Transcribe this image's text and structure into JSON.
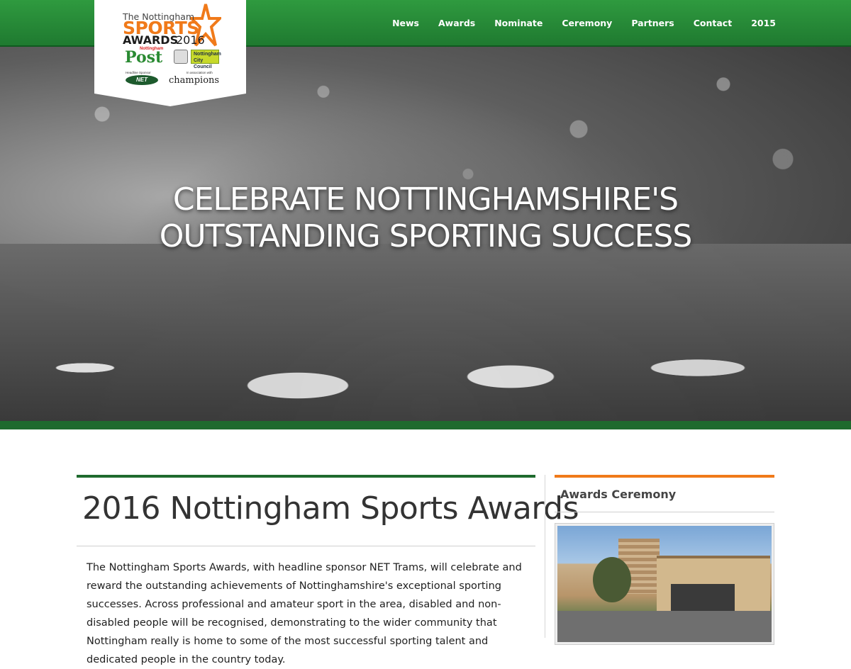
{
  "logo": {
    "line1": "The Nottingham",
    "sports": "SPORTS",
    "awards": "AWARDS",
    "year": "2016",
    "post_top": "Nottingham",
    "post": "Post",
    "council": "Nottingham City Council",
    "net_label": "Headline Sponsor",
    "net": "NET",
    "champions_label": "In association with",
    "champions": "champions"
  },
  "nav": {
    "items": [
      "News",
      "Awards",
      "Nominate",
      "Ceremony",
      "Partners",
      "Contact",
      "2015"
    ]
  },
  "hero": {
    "heading_line1": "CELEBRATE NOTTINGHAMSHIRE'S",
    "heading_line2": "OUTSTANDING SPORTING SUCCESS"
  },
  "main": {
    "title": "2016 Nottingham Sports Awards",
    "body": "The Nottingham Sports Awards, with headline sponsor NET Trams, will celebrate and reward the outstanding achievements of Nottinghamshire's exceptional sporting successes. Across professional and amateur sport in the area, disabled and non-disabled people will be recognised, demonstrating to the wider community that Nottingham really is home to some of the most successful sporting talent and dedicated people in the country today."
  },
  "sidebar": {
    "title": "Awards Ceremony"
  },
  "colors": {
    "brand_green": "#1f7a30",
    "accent_orange": "#f07a1a"
  }
}
